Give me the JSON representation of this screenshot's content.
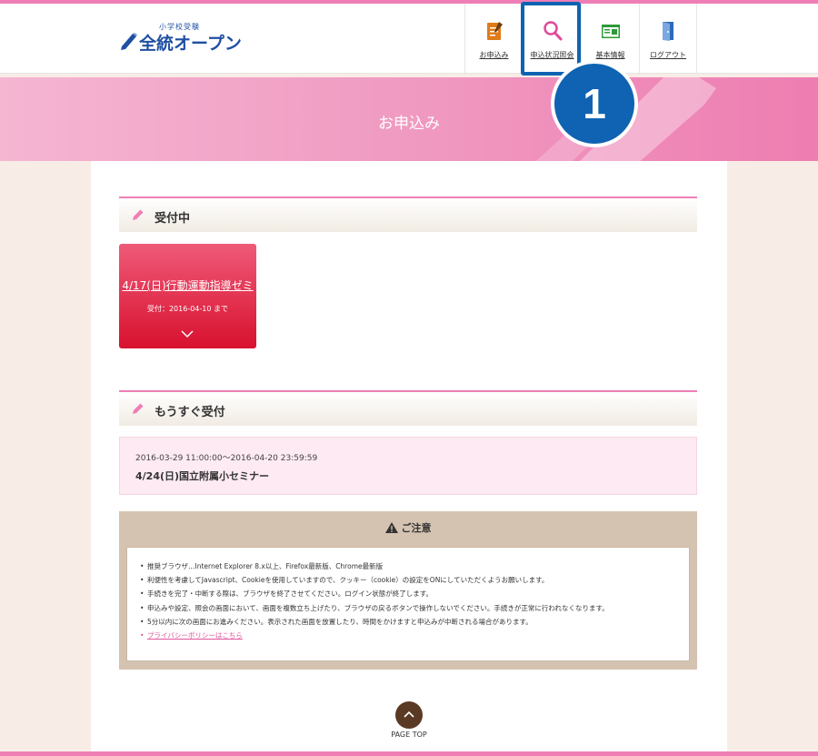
{
  "header": {
    "logo": {
      "small": "小学校受験",
      "main": "全統オープン"
    },
    "nav": [
      {
        "label": "お申込み",
        "icon": "application-form-icon",
        "color": "#e07b1a"
      },
      {
        "label": "申込状況照会",
        "icon": "search-icon",
        "color": "#e04a9a"
      },
      {
        "label": "基本情報",
        "icon": "id-card-icon",
        "color": "#2e9a3a"
      },
      {
        "label": "ログアウト",
        "icon": "logout-door-icon",
        "color": "#2d6ab8"
      }
    ]
  },
  "annotation": {
    "badge": "1",
    "color": "#0f63b2"
  },
  "banner": {
    "title": "お申込み"
  },
  "sections": {
    "accepting": {
      "title": "受付中",
      "card": {
        "title": "4/17(日)行動運動指導ゼミ",
        "deadline": "受付：2016-04-10 まで"
      }
    },
    "upcoming": {
      "title": "もうすぐ受付",
      "item": {
        "period": "2016-03-29 11:00:00～2016-04-20 23:59:59",
        "title": "4/24(日)国立附属小セミナー"
      }
    }
  },
  "notice": {
    "title": "ご注意",
    "items": [
      "推奨ブラウザ…Internet Explorer 8.x以上、Firefox最新版、Chrome最新版",
      "利便性を考慮してJavascript、Cookieを使用していますので、クッキー（cookie）の設定をONにしていただくようお願いします。",
      "手続きを完了・中断する際は、ブラウザを終了させてください。ログイン状態が終了します。",
      "申込みや設定、照会の画面において、画面を複数立ち上げたり、ブラウザの戻るボタンで操作しないでください。手続きが正常に行われなくなります。",
      "5分以内に次の画面にお進みください。表示された画面を放置したり、時間をかけますと申込みが中断される場合があります。"
    ],
    "privacy_link": "プライバシーポリシーはこちら"
  },
  "pagetop": {
    "label": "PAGE TOP"
  },
  "colors": {
    "accent_pink": "#ef7eb5",
    "card_red": "#d8112e",
    "brand_blue": "#1f4fa3"
  }
}
